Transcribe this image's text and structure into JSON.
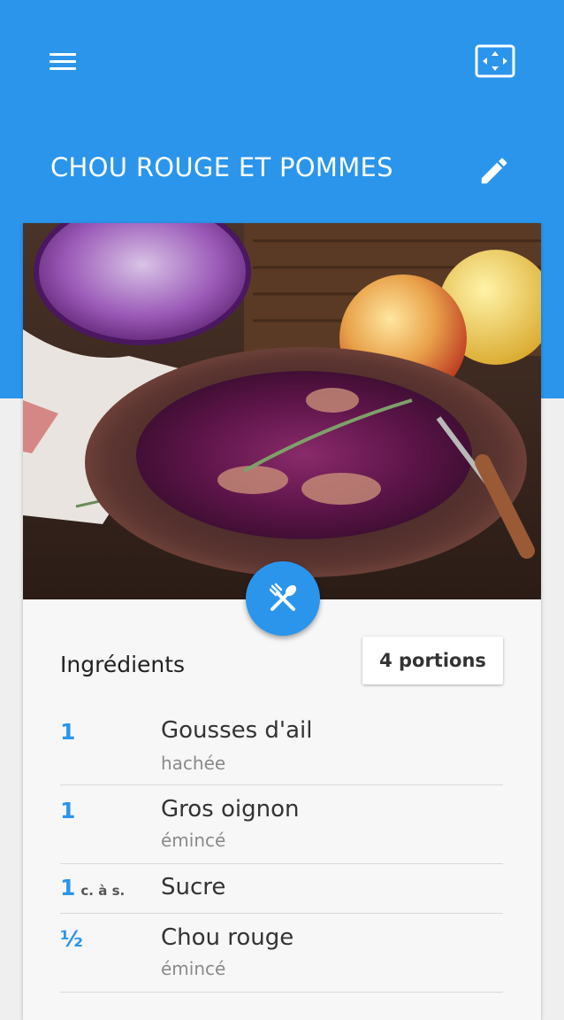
{
  "app_bar": {
    "menu_icon": "hamburger-menu-icon",
    "fullscreen_icon": "fullscreen-icon",
    "title": "CHOU ROUGE ET POMMES",
    "edit_icon": "pencil-icon",
    "color": "#2b95ec"
  },
  "recipe_photo": {
    "subject": "red cabbage with apples",
    "fab_icon": "cutlery-icon"
  },
  "ingredients": {
    "heading": "Ingrédients",
    "portions_label": "4 portions",
    "items": [
      {
        "qty": "1",
        "unit": "",
        "name": "Gousses d'ail",
        "note": "hachée"
      },
      {
        "qty": "1",
        "unit": "",
        "name": "Gros oignon",
        "note": "émincé"
      },
      {
        "qty": "1",
        "unit": "c. à s.",
        "name": "Sucre",
        "note": ""
      },
      {
        "qty": "½",
        "unit": "",
        "name": "Chou rouge",
        "note": "émincé"
      }
    ]
  }
}
